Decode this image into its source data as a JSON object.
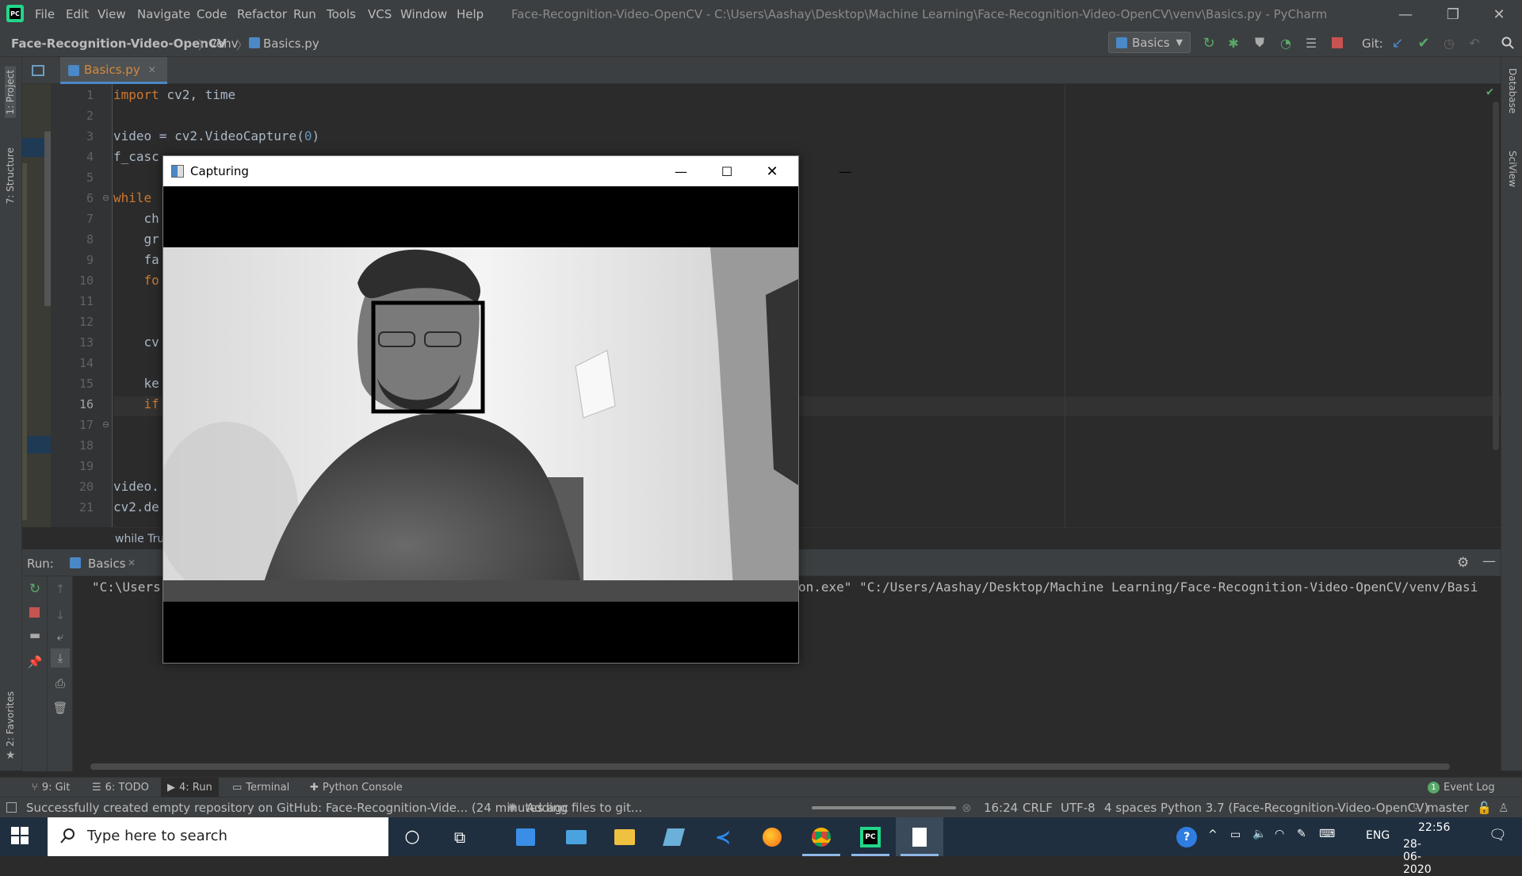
{
  "menubar": {
    "items": [
      "File",
      "Edit",
      "View",
      "Navigate",
      "Code",
      "Refactor",
      "Run",
      "Tools",
      "VCS",
      "Window",
      "Help"
    ],
    "title": "Face-Recognition-Video-OpenCV - C:\\Users\\Aashay\\Desktop\\Machine Learning\\Face-Recognition-Video-OpenCV\\venv\\Basics.py - PyCharm"
  },
  "navbar": {
    "project": "Face-Recognition-Video-OpenCV",
    "folder": "venv",
    "file": "Basics.py",
    "run_config": "Basics",
    "git_label": "Git:"
  },
  "sidebar_left": {
    "project": "1: Project",
    "structure": "7: Structure",
    "favorites": "2: Favorites"
  },
  "sidebar_right": {
    "database": "Database",
    "sciview": "SciView"
  },
  "editor": {
    "tab_label": "Basics.py",
    "line_numbers": [
      "1",
      "2",
      "3",
      "4",
      "5",
      "6",
      "7",
      "8",
      "9",
      "10",
      "11",
      "12",
      "13",
      "14",
      "15",
      "16",
      "17",
      "18",
      "19",
      "20",
      "21"
    ],
    "current_line": "16",
    "lines": {
      "l1_kw": "import",
      "l1_rest": " cv2, time",
      "l3_a": "video = cv2.VideoCapture(",
      "l3_num": "0",
      "l3_b": ")",
      "l4": "f_casc",
      "l6_kw": "while",
      "l7": "    ch",
      "l8": "    gr",
      "l9": "    fa",
      "l10": "    fo",
      "l13": "    cv",
      "l15": "    ke",
      "l16": "    if",
      "l20": "video.",
      "l21": "cv2.de"
    },
    "breadcrumb": "while Tru"
  },
  "run_panel": {
    "label": "Run:",
    "tab": "Basics",
    "output_left": "\"C:\\Users",
    "output_right": "on.exe\" \"C:/Users/Aashay/Desktop/Machine Learning/Face-Recognition-Video-OpenCV/venv/Basi"
  },
  "tool_tabs": {
    "git": "9: Git",
    "todo": "6: TODO",
    "run": "4: Run",
    "terminal": "Terminal",
    "python_console": "Python Console",
    "event_log": "Event Log",
    "event_count": "1"
  },
  "status_bar": {
    "message": "Successfully created empty repository on GitHub: Face-Recognition-Vide... (24 minutes agc",
    "task": "Adding files to git...",
    "position": "16:24",
    "line_sep": "CRLF",
    "encoding": "UTF-8",
    "indent": "4 spaces",
    "interpreter": "Python 3.7 (Face-Recognition-Video-OpenCV)",
    "branch": "master"
  },
  "capture_window": {
    "title": "Capturing"
  },
  "taskbar": {
    "search_placeholder": "Type here to search",
    "language": "ENG",
    "time": "22:56",
    "date": "28-06-2020"
  }
}
